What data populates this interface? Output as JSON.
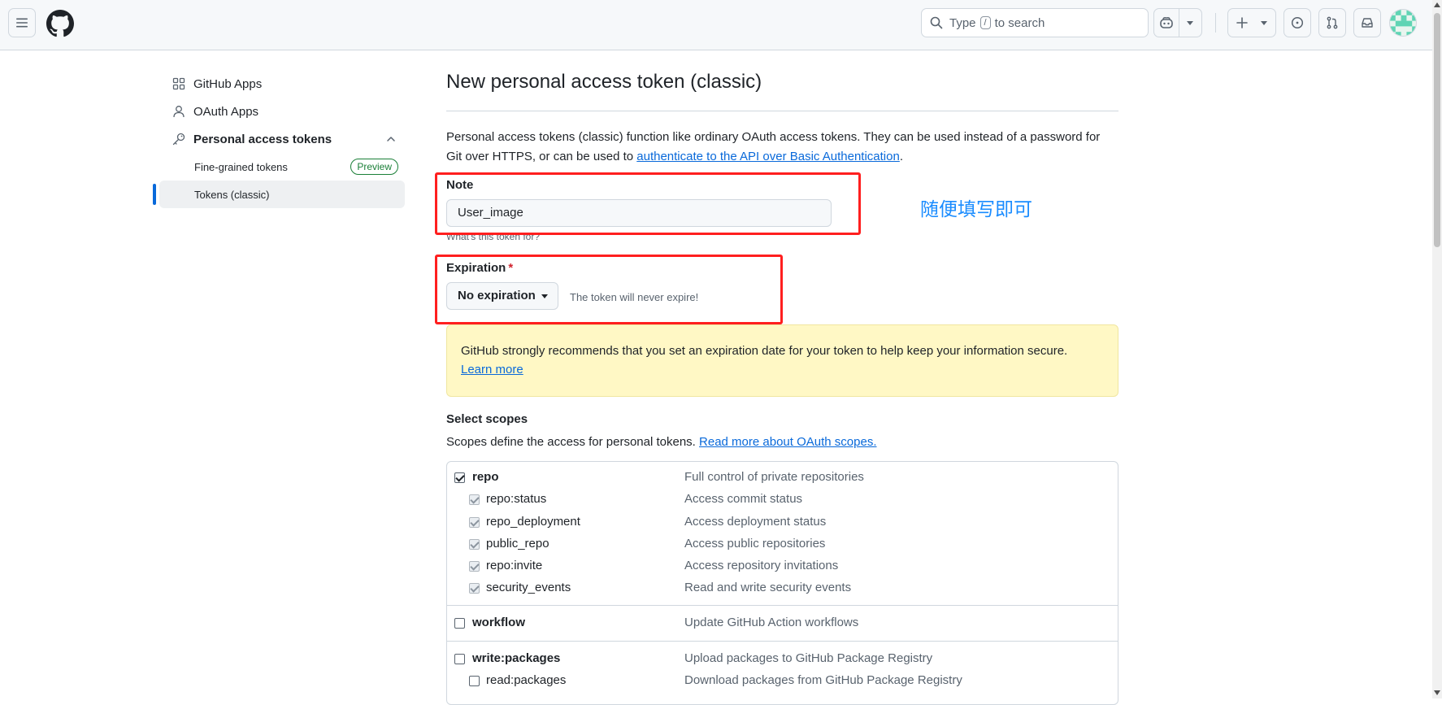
{
  "header": {
    "search_prefix": "Type",
    "search_key": "/",
    "search_suffix": "to search"
  },
  "sidebar": {
    "items": [
      {
        "label": "GitHub Apps"
      },
      {
        "label": "OAuth Apps"
      },
      {
        "label": "Personal access tokens"
      }
    ],
    "subitems": [
      {
        "label": "Fine-grained tokens",
        "badge": "Preview"
      },
      {
        "label": "Tokens (classic)"
      }
    ]
  },
  "main": {
    "title": "New personal access token (classic)",
    "desc_text": "Personal access tokens (classic) function like ordinary OAuth access tokens. They can be used instead of a password for Git over HTTPS, or can be used to ",
    "desc_link": "authenticate to the API over Basic Authentication",
    "desc_end": ".",
    "note": {
      "label": "Note",
      "value": "User_image",
      "hint": "What's this token for?"
    },
    "expiration": {
      "label": "Expiration",
      "required_mark": "*",
      "selected": "No expiration",
      "hint": "The token will never expire!"
    },
    "warning": {
      "text": "GitHub strongly recommends that you set an expiration date for your token to help keep your information secure.",
      "link": "Learn more"
    },
    "scopes": {
      "title": "Select scopes",
      "desc": "Scopes define the access for personal tokens.",
      "link": "Read more about OAuth scopes.",
      "groups": [
        {
          "name": "repo",
          "desc": "Full control of private repositories",
          "checked": true,
          "children": [
            {
              "name": "repo:status",
              "desc": "Access commit status"
            },
            {
              "name": "repo_deployment",
              "desc": "Access deployment status"
            },
            {
              "name": "public_repo",
              "desc": "Access public repositories"
            },
            {
              "name": "repo:invite",
              "desc": "Access repository invitations"
            },
            {
              "name": "security_events",
              "desc": "Read and write security events"
            }
          ]
        },
        {
          "name": "workflow",
          "desc": "Update GitHub Action workflows",
          "checked": false,
          "children": []
        },
        {
          "name": "write:packages",
          "desc": "Upload packages to GitHub Package Registry",
          "checked": false,
          "children": [
            {
              "name": "read:packages",
              "desc": "Download packages from GitHub Package Registry"
            }
          ]
        }
      ]
    }
  },
  "annotation": {
    "text": "随便填写即可",
    "box_color": "#ff1f1f",
    "text_color": "#1a8cff"
  }
}
